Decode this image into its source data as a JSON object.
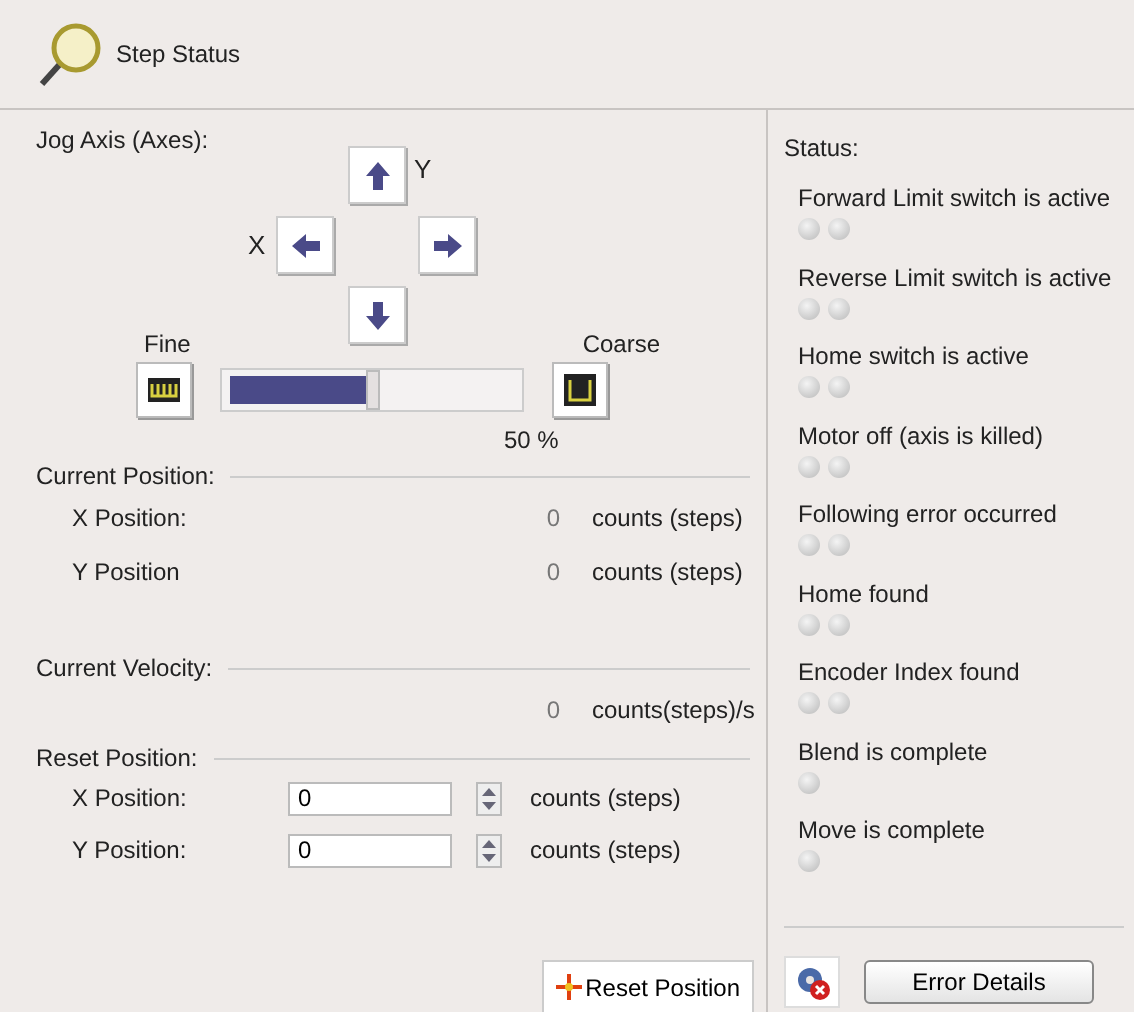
{
  "header": {
    "title": "Step Status"
  },
  "jog": {
    "label": "Jog Axis (Axes):",
    "x_label": "X",
    "y_label": "Y",
    "fine_label": "Fine",
    "coarse_label": "Coarse",
    "speed": {
      "level": 0.5,
      "reading": "50 %"
    }
  },
  "current_position": {
    "heading": "Current Position:",
    "rows": [
      {
        "label": "X Position:",
        "value": "0",
        "unit": "counts (steps)"
      },
      {
        "label": "Y Position",
        "value": "0",
        "unit": "counts (steps)"
      }
    ]
  },
  "current_velocity": {
    "heading": "Current Velocity:",
    "value": "0",
    "unit": "counts(steps)/s"
  },
  "reset_position": {
    "heading": "Reset Position:",
    "rows": [
      {
        "label": "X Position:",
        "value": "0",
        "unit": "counts (steps)"
      },
      {
        "label": "Y Position:",
        "value": "0",
        "unit": "counts (steps)"
      }
    ],
    "button": "Reset Position"
  },
  "status": {
    "heading": "Status:",
    "items": [
      {
        "label": "Forward Limit switch is active",
        "lamps": [
          {
            "on": false
          },
          {
            "on": false
          }
        ]
      },
      {
        "label": "Reverse Limit switch is active",
        "lamps": [
          {
            "on": false
          },
          {
            "on": false
          }
        ]
      },
      {
        "label": "Home switch is active",
        "lamps": [
          {
            "on": false
          },
          {
            "on": false
          }
        ]
      },
      {
        "label": "Motor off (axis is killed)",
        "lamps": [
          {
            "on": false
          },
          {
            "on": false
          }
        ]
      },
      {
        "label": "Following error occurred",
        "lamps": [
          {
            "on": false
          },
          {
            "on": false
          }
        ]
      },
      {
        "label": "Home found",
        "lamps": [
          {
            "on": false
          },
          {
            "on": false
          }
        ]
      },
      {
        "label": "Encoder Index found",
        "lamps": [
          {
            "on": false
          },
          {
            "on": false
          }
        ]
      },
      {
        "label": "Blend is complete",
        "lamps": [
          {
            "on": false
          }
        ]
      },
      {
        "label": "Move is complete",
        "lamps": [
          {
            "on": false
          }
        ]
      }
    ],
    "error_button": "Error Details"
  }
}
